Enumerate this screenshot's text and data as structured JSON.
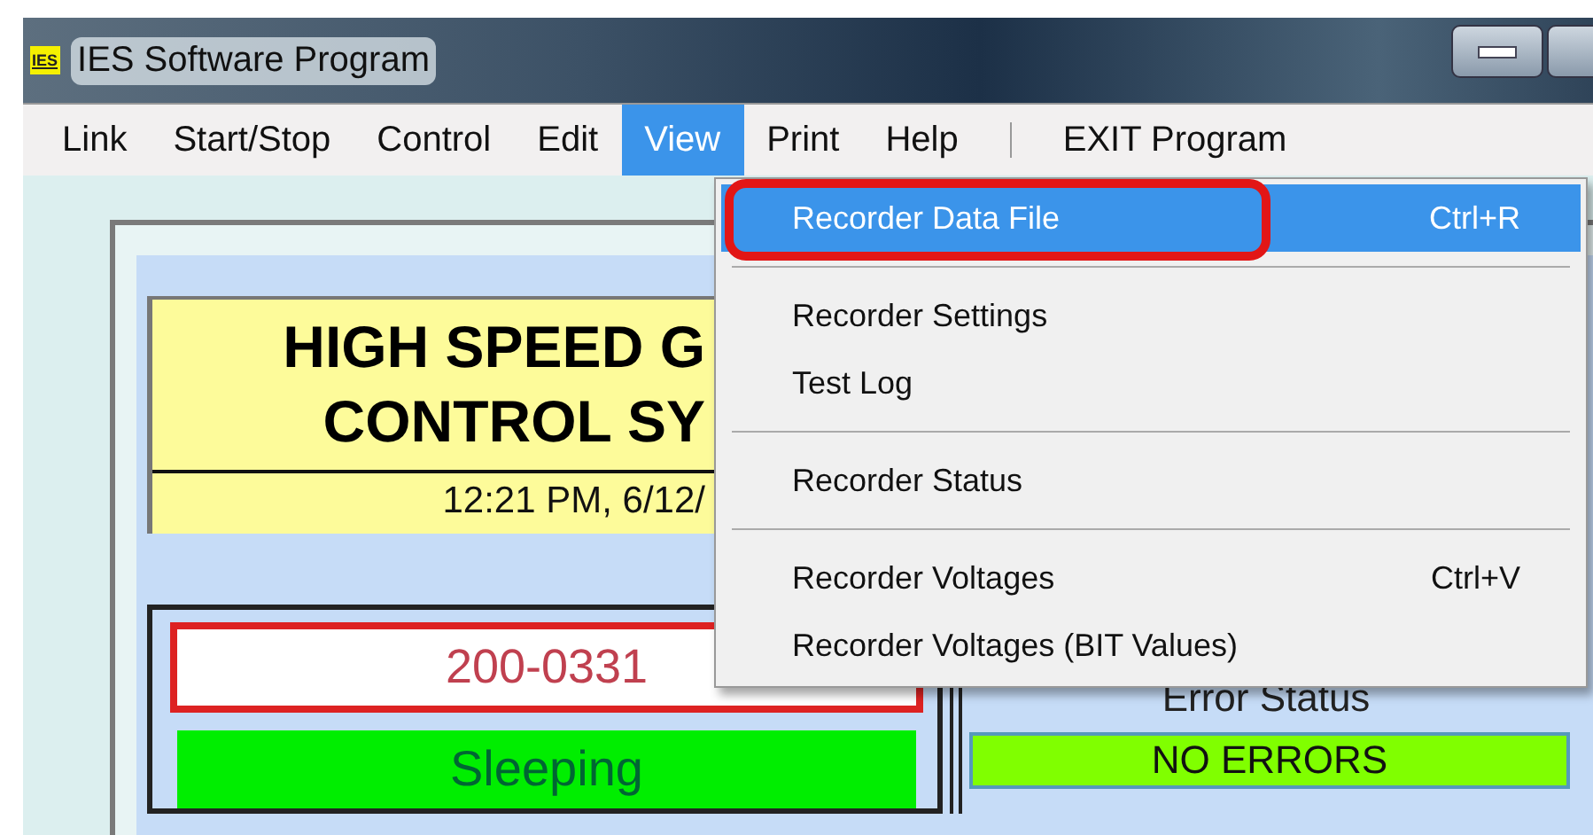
{
  "window": {
    "title": "IES Software Program",
    "icon_text": "IES"
  },
  "menu_bar": [
    {
      "kind": "item",
      "label": "Link",
      "selected": false
    },
    {
      "kind": "item",
      "label": "Start/Stop",
      "selected": false
    },
    {
      "kind": "item",
      "label": "Control",
      "selected": false
    },
    {
      "kind": "item",
      "label": "Edit",
      "selected": false
    },
    {
      "kind": "item",
      "label": "View",
      "selected": true
    },
    {
      "kind": "item",
      "label": "Print",
      "selected": false
    },
    {
      "kind": "item",
      "label": "Help",
      "selected": false
    },
    {
      "kind": "separator"
    },
    {
      "kind": "item",
      "label": "EXIT Program",
      "selected": false
    }
  ],
  "view_menu": [
    {
      "kind": "item",
      "label": "Recorder Data File",
      "shortcut": "Ctrl+R",
      "selected": true,
      "circled": true
    },
    {
      "kind": "separator"
    },
    {
      "kind": "item",
      "label": "Recorder Settings",
      "selected": false,
      "circled": false
    },
    {
      "kind": "item",
      "label": "Test Log",
      "selected": false,
      "circled": false
    },
    {
      "kind": "separator"
    },
    {
      "kind": "item",
      "label": "Recorder Status",
      "selected": false,
      "circled": false
    },
    {
      "kind": "separator"
    },
    {
      "kind": "item",
      "label": "Recorder Voltages",
      "shortcut": "Ctrl+V",
      "selected": false,
      "circled": false
    },
    {
      "kind": "item",
      "label": "Recorder Voltages (BIT Values)",
      "selected": false,
      "circled": false
    }
  ],
  "header": {
    "title_lines": [
      "HIGH SPEED G",
      "CONTROL SY"
    ],
    "timestamp": "12:21 PM,  6/12/"
  },
  "unit": {
    "id": "200-0331",
    "status": "Sleeping"
  },
  "error": {
    "label": "Error Status",
    "value": "NO ERRORS"
  }
}
